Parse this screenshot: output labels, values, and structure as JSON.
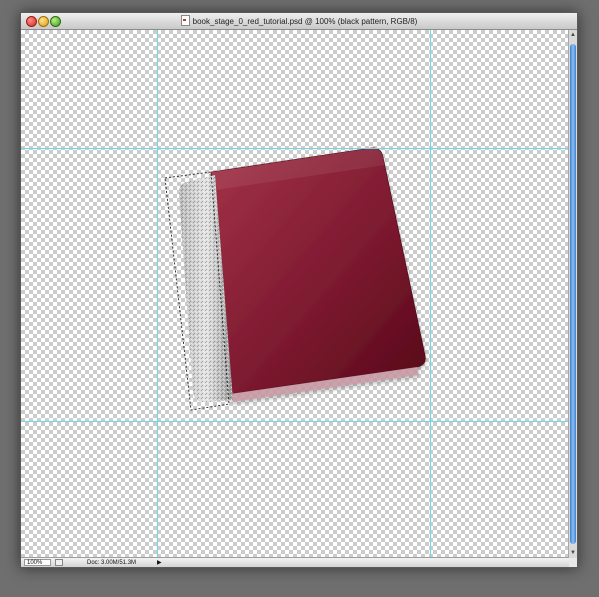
{
  "window": {
    "title": "book_stage_0_red_tutorial.psd @ 100% (black pattern, RGB/8)"
  },
  "statusbar": {
    "zoom": "100%",
    "doc_info": "Doc: 3.00M/51.3M",
    "arrow": "▶"
  },
  "colors": {
    "cover_light": "#9b2a3f",
    "cover_dark": "#5a0a1e",
    "guide": "#6fd8e6",
    "scroll_thumb": "#3b7fd4"
  },
  "icons": {
    "close": "close-icon",
    "minimize": "minimize-icon",
    "zoom": "zoom-icon",
    "document": "psd-document-icon"
  }
}
